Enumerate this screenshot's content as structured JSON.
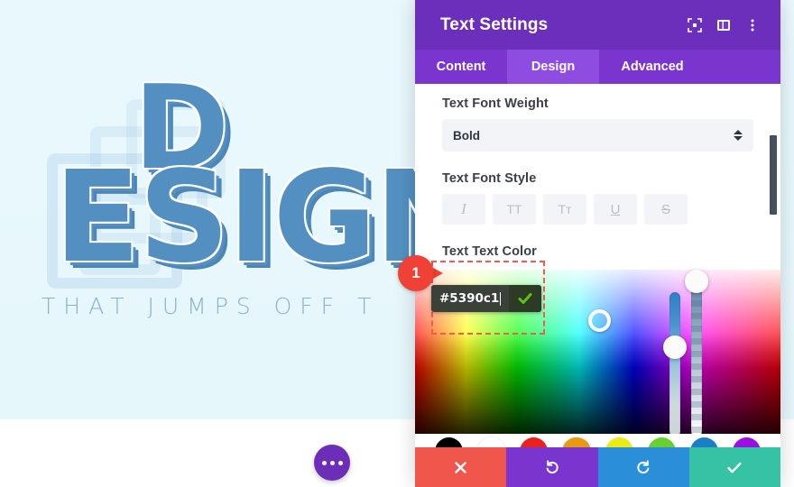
{
  "canvas": {
    "hero": {
      "word_top": "D",
      "word_main": "ESIGN",
      "subtitle": "THAT JUMPS OFF T",
      "text_color": "#5390c1",
      "background_color": "#e8f7fc"
    },
    "fab": {
      "name": "more-options",
      "label": "•••"
    }
  },
  "modal": {
    "title": "Text Settings",
    "header_icons": [
      {
        "name": "fullscreen-icon",
        "label": "Fullscreen"
      },
      {
        "name": "layout-icon",
        "label": "Change Layout"
      },
      {
        "name": "more-vertical-icon",
        "label": "More"
      }
    ],
    "accent_color": "#6b2fbb",
    "tab_active_color": "#8f4ce0",
    "tabs": [
      {
        "label": "Content",
        "active": false
      },
      {
        "label": "Design",
        "active": true
      },
      {
        "label": "Advanced",
        "active": false
      }
    ],
    "fields": {
      "font_weight_label": "Text Font Weight",
      "font_weight_value": "Bold",
      "font_style_label": "Text Font Style",
      "font_style_buttons": [
        {
          "name": "italic-button",
          "glyph": "I"
        },
        {
          "name": "uppercase-button",
          "glyph": "TT"
        },
        {
          "name": "small-caps-button",
          "glyph": "Tᴛ"
        },
        {
          "name": "underline-button",
          "glyph": "U"
        },
        {
          "name": "strikethrough-button",
          "glyph": "S"
        }
      ],
      "text_color_label": "Text Text Color"
    },
    "color_picker": {
      "hex_value": "#5390c1",
      "confirm_label": "✓",
      "swatches": [
        {
          "name": "swatch-black",
          "color": "#000000"
        },
        {
          "name": "swatch-white",
          "color": "#ffffff"
        },
        {
          "name": "swatch-red",
          "color": "#e8231e"
        },
        {
          "name": "swatch-orange",
          "color": "#e99a13"
        },
        {
          "name": "swatch-yellow",
          "color": "#ecec14"
        },
        {
          "name": "swatch-green",
          "color": "#68d131"
        },
        {
          "name": "swatch-blue",
          "color": "#1a7fc5"
        },
        {
          "name": "swatch-purple",
          "color": "#9b10e0"
        }
      ]
    },
    "actions": [
      {
        "name": "close-button",
        "glyph": "✕",
        "color": "#f0564c"
      },
      {
        "name": "undo-button",
        "glyph": "↺",
        "color": "#7b35cf"
      },
      {
        "name": "redo-button",
        "glyph": "↻",
        "color": "#2a8fd8"
      },
      {
        "name": "save-button",
        "glyph": "✓",
        "color": "#36c2a4"
      }
    ]
  },
  "annotation": {
    "step_number": "1",
    "marker_color": "#ef4136",
    "highlight_color": "#f05a4f"
  }
}
